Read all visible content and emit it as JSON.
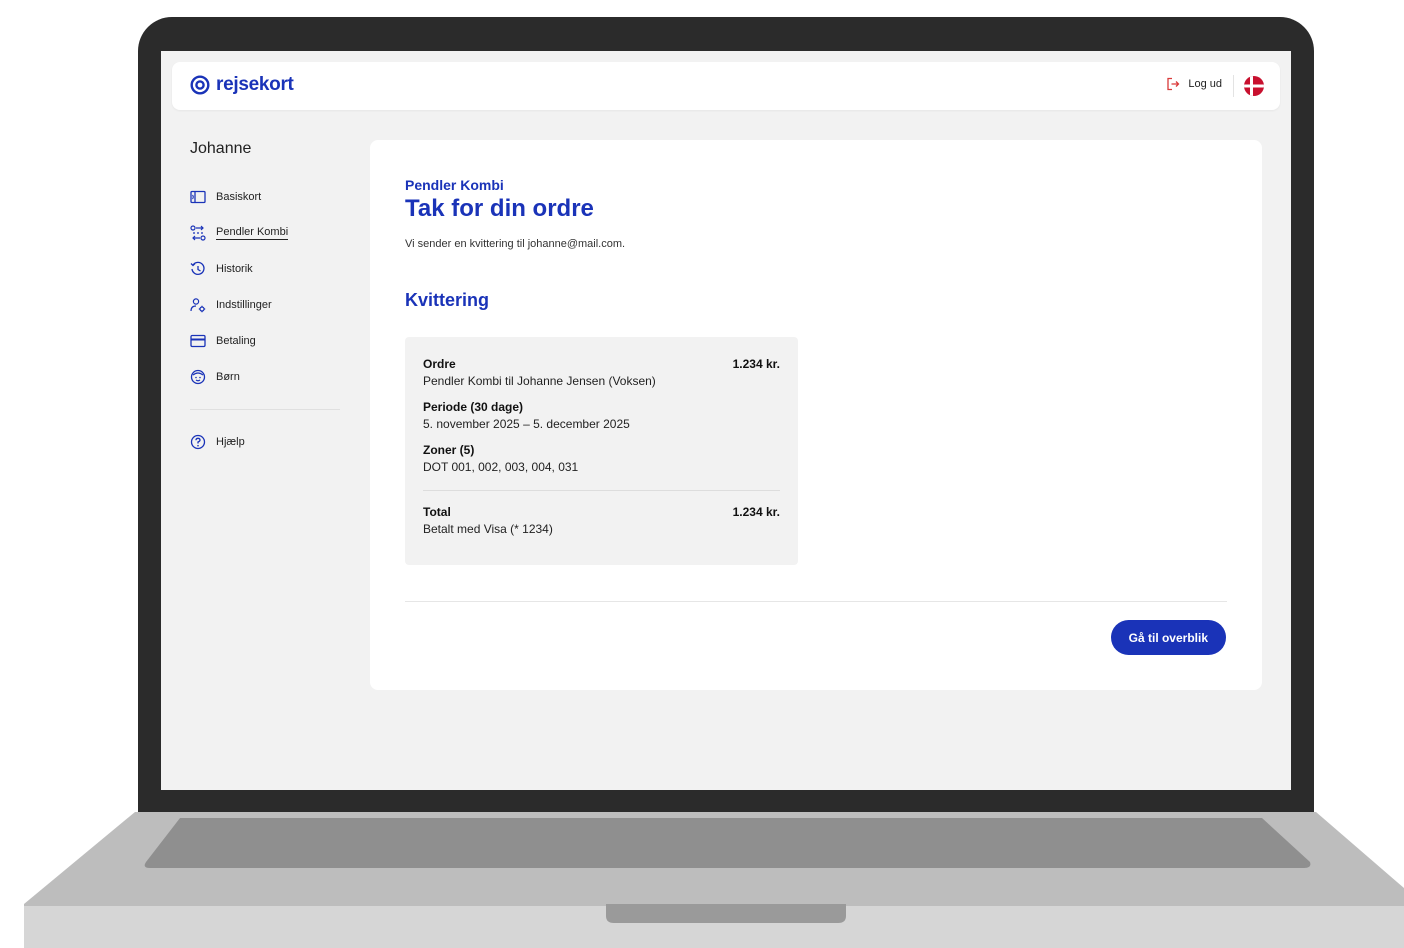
{
  "header": {
    "logo_text": "rejsekort",
    "logout_label": "Log ud"
  },
  "sidebar": {
    "user_name": "Johanne",
    "items": [
      {
        "label": "Basiskort",
        "icon": "card-icon"
      },
      {
        "label": "Pendler Kombi",
        "icon": "transfer-icon",
        "active": true
      },
      {
        "label": "Historik",
        "icon": "history-icon"
      },
      {
        "label": "Indstillinger",
        "icon": "settings-user-icon"
      },
      {
        "label": "Betaling",
        "icon": "credit-card-icon"
      },
      {
        "label": "Børn",
        "icon": "child-face-icon"
      }
    ],
    "help_label": "Hjælp"
  },
  "main": {
    "eyebrow": "Pendler Kombi",
    "title": "Tak for din ordre",
    "subtext": "Vi sender en kvittering til johanne@mail.com.",
    "receipt_title": "Kvittering",
    "receipt": {
      "order_heading": "Ordre",
      "order_amount": "1.234 kr.",
      "order_desc": "Pendler Kombi til Johanne Jensen (Voksen)",
      "period_heading": "Periode (30 dage)",
      "period_desc": "5. november 2025 – 5. december 2025",
      "zones_heading": "Zoner (5)",
      "zones_desc": "DOT 001, 002, 003, 004, 031",
      "total_heading": "Total",
      "total_amount": "1.234 kr.",
      "total_desc": "Betalt med Visa (* 1234)"
    },
    "cta_label": "Gå til overblik"
  },
  "colors": {
    "brand": "#1a33b8",
    "flag_red": "#c8102e"
  }
}
